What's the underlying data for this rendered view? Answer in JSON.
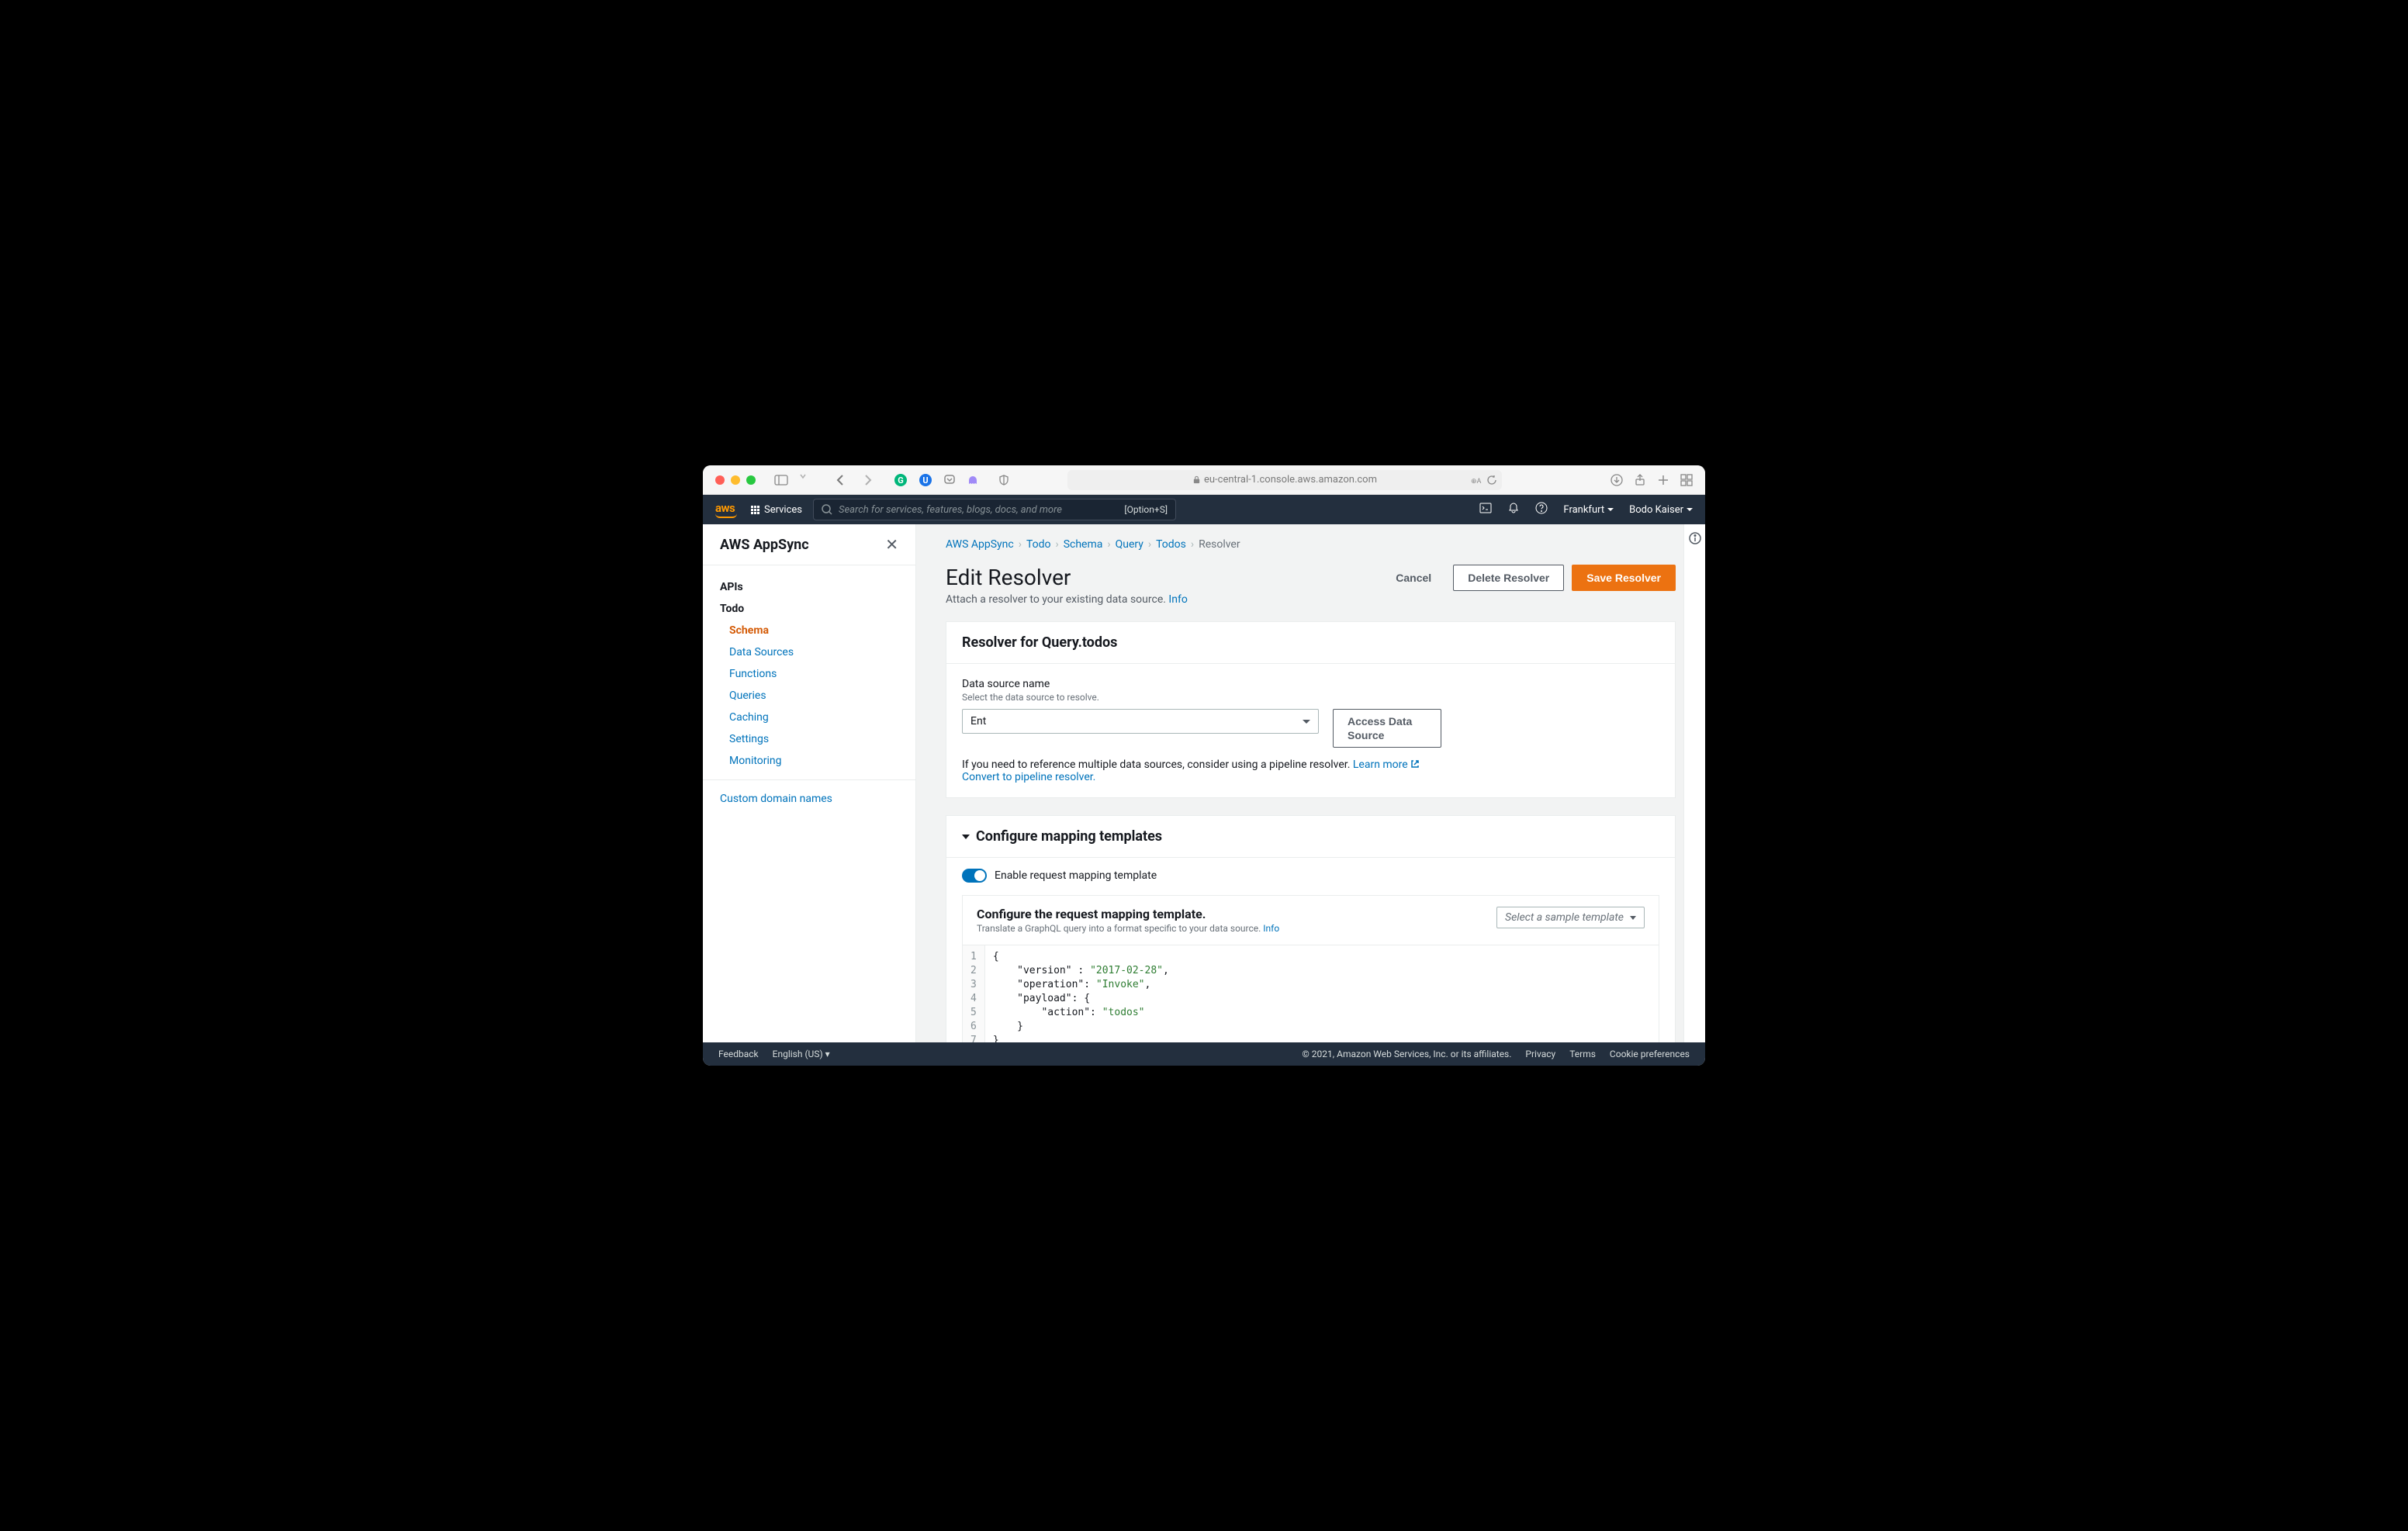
{
  "browser": {
    "url": "eu-central-1.console.aws.amazon.com"
  },
  "awsbar": {
    "logo": "aws",
    "services": "Services",
    "search_placeholder": "Search for services, features, blogs, docs, and more",
    "search_hint": "[Option+S]",
    "region": "Frankfurt",
    "user": "Bodo Kaiser"
  },
  "sidebar": {
    "title": "AWS AppSync",
    "items": {
      "apis": "APIs",
      "todo": "Todo",
      "schema": "Schema",
      "data_sources": "Data Sources",
      "functions": "Functions",
      "queries": "Queries",
      "caching": "Caching",
      "settings": "Settings",
      "monitoring": "Monitoring",
      "custom_domains": "Custom domain names"
    }
  },
  "breadcrumbs": [
    "AWS AppSync",
    "Todo",
    "Schema",
    "Query",
    "Todos",
    "Resolver"
  ],
  "page": {
    "title": "Edit Resolver",
    "subtitle": "Attach a resolver to your existing data source.",
    "info": "Info",
    "cancel": "Cancel",
    "delete": "Delete Resolver",
    "save": "Save Resolver"
  },
  "resolver_panel": {
    "heading": "Resolver for Query.todos",
    "ds_label": "Data source name",
    "ds_hint": "Select the data source to resolve.",
    "ds_value": "Ent",
    "access_btn": "Access Data Source",
    "pipeline_text": "If you need to reference multiple data sources, consider using a pipeline resolver.",
    "learn_more": "Learn more",
    "convert": "Convert to pipeline resolver."
  },
  "mapping_panel": {
    "heading": "Configure mapping templates",
    "toggle_label": "Enable request mapping template",
    "req_title": "Configure the request mapping template.",
    "req_hint": "Translate a GraphQL query into a format specific to your data source.",
    "info": "Info",
    "sample_placeholder": "Select a sample template",
    "code": {
      "l1": "{",
      "l2_a": "    \"version\" : ",
      "l2_b": "\"2017-02-28\"",
      "l2_c": ",",
      "l3_a": "    \"operation\": ",
      "l3_b": "\"Invoke\"",
      "l3_c": ",",
      "l4": "    \"payload\": {",
      "l5_a": "        \"action\": ",
      "l5_b": "\"todos\"",
      "l6": "    }",
      "l7": "}"
    }
  },
  "footer": {
    "feedback": "Feedback",
    "language": "English (US)",
    "copyright": "© 2021, Amazon Web Services, Inc. or its affiliates.",
    "privacy": "Privacy",
    "terms": "Terms",
    "cookies": "Cookie preferences"
  }
}
